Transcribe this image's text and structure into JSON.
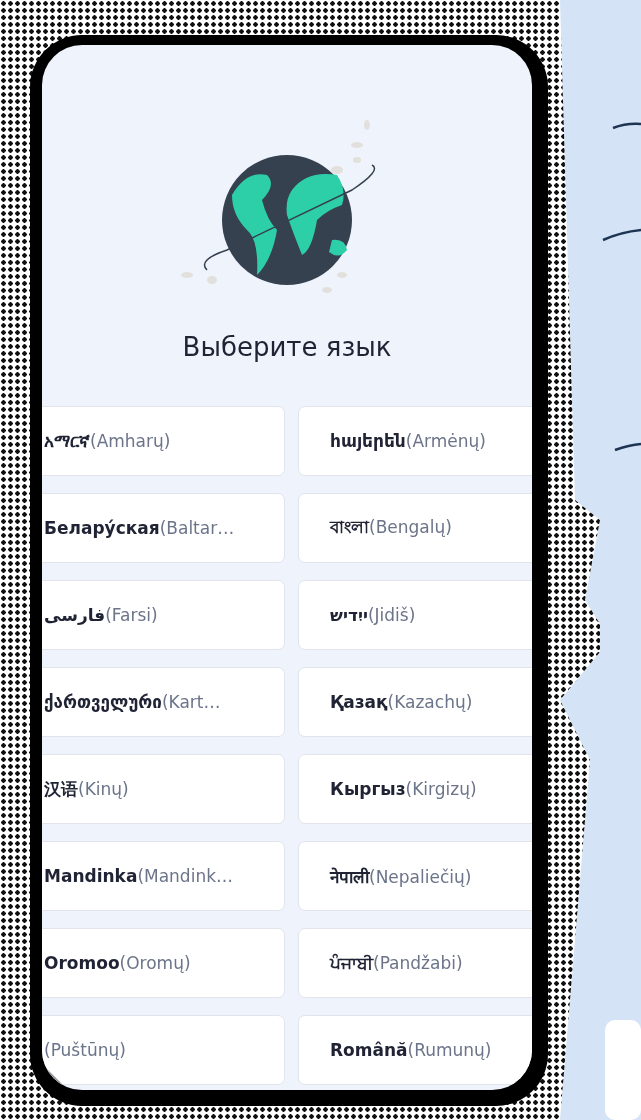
{
  "title": "Выберите язык",
  "languages": [
    {
      "label": "**አማርኛ**(Amharų)"
    },
    {
      "label": "**հայերեն**(Armėnų)"
    },
    {
      "label": "**Белару́ская**(Baltar…"
    },
    {
      "label": "**বাংলা**(Bengalų)"
    },
    {
      "label": "**فارسی**(Farsi)"
    },
    {
      "label": "**ייִדיש**(Jidiš)"
    },
    {
      "label": "**ქართველური**(Kart…"
    },
    {
      "label": "**Қазақ**(Kazachų)"
    },
    {
      "label": "**汉语**(Kinų)"
    },
    {
      "label": "**Кыргыз**(Kirgizų)"
    },
    {
      "label": "**Mandinka**(Mandink…"
    },
    {
      "label": "**नेपाली**(Nepaliečių)"
    },
    {
      "label": "**Oromoo**(Oromų)"
    },
    {
      "label": "**ਪੰਜਾਬੀ**(Pandžabi)"
    },
    {
      "label": "(Puštūnų)"
    },
    {
      "label": "**Română**(Rumunų)"
    }
  ]
}
